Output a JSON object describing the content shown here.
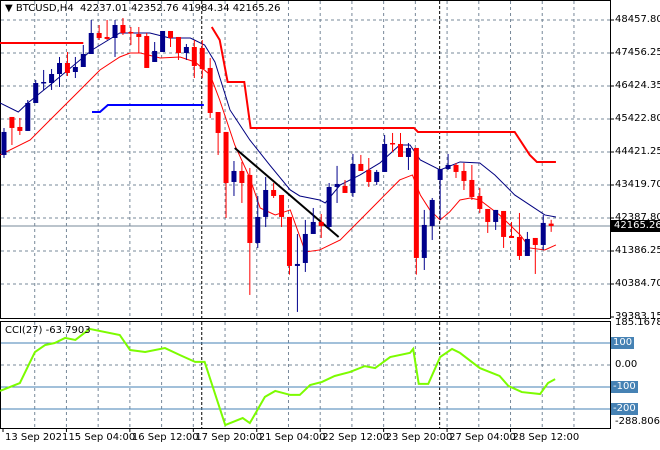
{
  "header": {
    "symbol": "BTCUSD,H4",
    "open": "42237.01",
    "high": "42352.76",
    "low": "41984.34",
    "close": "42165.26"
  },
  "cci_header": {
    "name": "CCI(27)",
    "value": "-63.7903"
  },
  "colors": {
    "bull": "#00008b",
    "bear": "#ff0000",
    "ma_fast": "#000080",
    "ma_slow": "#ff0000",
    "step_red": "#ff0000",
    "step_blue": "#0000ff",
    "trendline": "#000000",
    "cci": "#7cfc00",
    "grid": "#778899",
    "level": "#4682b4"
  },
  "chart_data": [
    {
      "type": "candlestick",
      "title": "BTCUSD,H4",
      "ylim": [
        39383.15,
        48457.8
      ],
      "y_ticks": [
        "48457.80",
        "47456.25",
        "46424.35",
        "45422.80",
        "44421.25",
        "43419.70",
        "42387.80",
        "41386.25",
        "40384.70",
        "39383.15"
      ],
      "current_price": "42165.26",
      "x_ticks": [
        "13 Sep 2021",
        "15 Sep 04:00",
        "16 Sep 12:00",
        "17 Sep 20:00",
        "21 Sep 04:00",
        "22 Sep 12:00",
        "23 Sep 20:00",
        "27 Sep 04:00",
        "28 Sep 12:00"
      ],
      "x_tick_candles": [
        0,
        8,
        16,
        24,
        32,
        40,
        48,
        56,
        64
      ],
      "separators_at_candle": [
        25,
        55
      ],
      "ohlc": [
        [
          44334,
          45159,
          44242,
          45037
        ],
        [
          45495,
          45495,
          44639,
          45159
        ],
        [
          45189,
          45464,
          44945,
          45068
        ],
        [
          45068,
          46014,
          45068,
          45922
        ],
        [
          45922,
          46625,
          45922,
          46533
        ],
        [
          46533,
          46931,
          46320,
          46564
        ],
        [
          46533,
          46961,
          46320,
          46808
        ],
        [
          46808,
          47328,
          46411,
          47144
        ],
        [
          47144,
          47480,
          46747,
          46839
        ],
        [
          46869,
          47328,
          46686,
          47022
        ],
        [
          47022,
          47694,
          47022,
          47419
        ],
        [
          47419,
          48458,
          47419,
          48061
        ],
        [
          48061,
          48305,
          47847,
          47908
        ],
        [
          47939,
          48458,
          47847,
          47878
        ],
        [
          47908,
          48458,
          47328,
          48305
        ],
        [
          48305,
          48519,
          48000,
          48061
        ],
        [
          48091,
          48244,
          47694,
          48061
        ],
        [
          48030,
          48244,
          47450,
          47939
        ],
        [
          47969,
          48061,
          46992,
          46992
        ],
        [
          47175,
          47786,
          47175,
          47511
        ],
        [
          47480,
          48122,
          47480,
          48122
        ],
        [
          48122,
          48122,
          47633,
          47908
        ],
        [
          47939,
          47939,
          47236,
          47450
        ],
        [
          47450,
          47725,
          47236,
          47633
        ],
        [
          47633,
          47847,
          46686,
          47053
        ],
        [
          47603,
          47847,
          46686,
          46961
        ],
        [
          46992,
          47297,
          45464,
          45617
        ],
        [
          45647,
          45647,
          44334,
          45006
        ],
        [
          45037,
          45037,
          42409,
          43478
        ],
        [
          43509,
          44150,
          43081,
          43845
        ],
        [
          43845,
          44120,
          42867,
          43478
        ],
        [
          43723,
          43937,
          40057,
          41645
        ],
        [
          41645,
          43081,
          41493,
          42440
        ],
        [
          42440,
          43662,
          42134,
          43264
        ],
        [
          43264,
          43478,
          43020,
          43081
        ],
        [
          43112,
          43112,
          42134,
          42440
        ],
        [
          42440,
          42440,
          40678,
          40943
        ],
        [
          40943,
          41920,
          39538,
          41004
        ],
        [
          41034,
          42348,
          40760,
          41920
        ],
        [
          41920,
          42715,
          41920,
          42287
        ],
        [
          42287,
          42531,
          41798,
          42165
        ],
        [
          42134,
          43478,
          42043,
          43356
        ],
        [
          43356,
          44000,
          42867,
          43448
        ],
        [
          43387,
          43570,
          43173,
          43173
        ],
        [
          43173,
          44364,
          43051,
          44059
        ],
        [
          44059,
          44334,
          43845,
          43845
        ],
        [
          43876,
          44242,
          43356,
          43509
        ],
        [
          43509,
          43876,
          43418,
          43815
        ],
        [
          43815,
          44945,
          43815,
          44670
        ],
        [
          44700,
          45006,
          44425,
          44670
        ],
        [
          44670,
          45006,
          44273,
          44273
        ],
        [
          44273,
          44700,
          43876,
          44548
        ],
        [
          44548,
          44548,
          40678,
          41187
        ],
        [
          41187,
          42654,
          40820,
          42196
        ],
        [
          42165,
          43020,
          41737,
          42959
        ],
        [
          43570,
          43906,
          42348,
          43906
        ],
        [
          43906,
          44364,
          43876,
          44028
        ],
        [
          44028,
          44089,
          43631,
          43815
        ],
        [
          43845,
          44089,
          43264,
          43540
        ],
        [
          43570,
          44028,
          42959,
          43051
        ],
        [
          43081,
          43326,
          42562,
          42684
        ],
        [
          42684,
          42684,
          41951,
          42287
        ],
        [
          42287,
          42654,
          42043,
          42654
        ],
        [
          42623,
          42623,
          41493,
          41829
        ],
        [
          41859,
          42287,
          41798,
          41798
        ],
        [
          41829,
          42562,
          41126,
          41248
        ],
        [
          41248,
          41982,
          41248,
          41768
        ],
        [
          41798,
          41798,
          40698,
          41584
        ],
        [
          41584,
          42501,
          41432,
          42257
        ],
        [
          42237,
          42352,
          41984,
          42165
        ]
      ],
      "overlays": [
        {
          "name": "ma-fast",
          "points": [
            [
              -0.5,
              45922
            ],
            [
              1.8,
              45647
            ],
            [
              3.0,
              45922
            ],
            [
              5.8,
              46472
            ],
            [
              11.1,
              47542
            ],
            [
              14.6,
              48061
            ],
            [
              18.4,
              48061
            ],
            [
              20.9,
              47908
            ],
            [
              23.5,
              47908
            ],
            [
              25.3,
              47694
            ],
            [
              26.6,
              47175
            ],
            [
              28.5,
              45709
            ],
            [
              31.0,
              44792
            ],
            [
              33.5,
              44028
            ],
            [
              36.1,
              43264
            ],
            [
              37.3,
              43081
            ],
            [
              39.8,
              42959
            ],
            [
              40.5,
              42867
            ],
            [
              42.4,
              43418
            ],
            [
              44.9,
              43723
            ],
            [
              47.4,
              44089
            ],
            [
              49.9,
              44639
            ],
            [
              51.2,
              44639
            ],
            [
              52.5,
              44181
            ],
            [
              55.0,
              43876
            ],
            [
              57.5,
              44120
            ],
            [
              60.0,
              44089
            ],
            [
              61.9,
              43723
            ],
            [
              64.4,
              43112
            ],
            [
              66.3,
              42806
            ],
            [
              68.2,
              42501
            ],
            [
              69.6,
              42440
            ]
          ]
        },
        {
          "name": "ma-slow",
          "points": [
            [
              -0.5,
              44334
            ],
            [
              3.3,
              44792
            ],
            [
              5.8,
              45403
            ],
            [
              9.6,
              46320
            ],
            [
              12.1,
              46931
            ],
            [
              14.6,
              47328
            ],
            [
              15.9,
              47450
            ],
            [
              17.2,
              47450
            ],
            [
              19.7,
              47297
            ],
            [
              22.2,
              47328
            ],
            [
              24.1,
              47175
            ],
            [
              26.0,
              46778
            ],
            [
              27.2,
              46014
            ],
            [
              29.1,
              44639
            ],
            [
              31.0,
              43631
            ],
            [
              32.3,
              42715
            ],
            [
              34.2,
              42501
            ],
            [
              36.1,
              42654
            ],
            [
              38.0,
              41371
            ],
            [
              39.8,
              41432
            ],
            [
              42.4,
              41737
            ],
            [
              44.9,
              42348
            ],
            [
              47.4,
              42959
            ],
            [
              49.9,
              43570
            ],
            [
              51.5,
              43723
            ],
            [
              52.5,
              43112
            ],
            [
              53.7,
              42654
            ],
            [
              55.0,
              42348
            ],
            [
              56.2,
              42593
            ],
            [
              57.5,
              42959
            ],
            [
              58.8,
              43020
            ],
            [
              60.0,
              42959
            ],
            [
              62.5,
              42501
            ],
            [
              65.1,
              41890
            ],
            [
              66.3,
              41493
            ],
            [
              68.2,
              41432
            ],
            [
              69.6,
              41584
            ]
          ]
        },
        {
          "name": "step-red-1",
          "points": [
            [
              -0.5,
              47756
            ],
            [
              10,
              47756
            ]
          ]
        },
        {
          "name": "step-red-2",
          "points": [
            [
              26.2,
              48244
            ],
            [
              27.2,
              47847
            ],
            [
              28.2,
              46564
            ],
            [
              30.3,
              46564
            ],
            [
              31.1,
              45159
            ],
            [
              51.7,
              45159
            ],
            [
              52.2,
              45037
            ],
            [
              64.4,
              45037
            ],
            [
              66.3,
              44334
            ],
            [
              67.2,
              44120
            ],
            [
              69.6,
              44120
            ]
          ]
        },
        {
          "name": "step-blue",
          "points": [
            [
              11.1,
              45647
            ],
            [
              12.1,
              45647
            ],
            [
              13.1,
              45861
            ],
            [
              25.2,
              45861
            ]
          ]
        },
        {
          "name": "trendline",
          "points": [
            [
              29.1,
              44548
            ],
            [
              42.2,
              41829
            ]
          ]
        }
      ]
    },
    {
      "type": "line",
      "title": "CCI(27) -63.7903",
      "ylim": [
        -288.8062,
        185.1678
      ],
      "y_ticks": [
        "185.1678",
        "100",
        "0.00",
        "-100",
        "-200",
        "-288.8062"
      ],
      "levels": [
        100,
        -100,
        -200
      ],
      "points": [
        [
          -0.5,
          -118
        ],
        [
          2.0,
          -82
        ],
        [
          3.9,
          59
        ],
        [
          5.2,
          91
        ],
        [
          6.4,
          100
        ],
        [
          7.7,
          123
        ],
        [
          9.0,
          114
        ],
        [
          10.8,
          164
        ],
        [
          14.6,
          136
        ],
        [
          15.9,
          68
        ],
        [
          17.8,
          59
        ],
        [
          20.3,
          77
        ],
        [
          22.2,
          45
        ],
        [
          24.1,
          14
        ],
        [
          25.3,
          14
        ],
        [
          27.9,
          -273
        ],
        [
          30.1,
          -241
        ],
        [
          31.0,
          -264
        ],
        [
          32.9,
          -145
        ],
        [
          34.2,
          -118
        ],
        [
          36.1,
          -136
        ],
        [
          37.3,
          -136
        ],
        [
          38.6,
          -91
        ],
        [
          40.1,
          -77
        ],
        [
          41.7,
          -50
        ],
        [
          43.6,
          -32
        ],
        [
          45.5,
          -5
        ],
        [
          46.8,
          -14
        ],
        [
          48.7,
          36
        ],
        [
          51.2,
          55
        ],
        [
          51.6,
          73
        ],
        [
          52.3,
          -86
        ],
        [
          53.5,
          -86
        ],
        [
          55.0,
          36
        ],
        [
          56.5,
          73
        ],
        [
          57.5,
          55
        ],
        [
          60.0,
          -14
        ],
        [
          62.5,
          -50
        ],
        [
          63.6,
          -95
        ],
        [
          65.3,
          -123
        ],
        [
          67.6,
          -132
        ],
        [
          68.6,
          -82
        ],
        [
          69.5,
          -64
        ]
      ]
    }
  ]
}
